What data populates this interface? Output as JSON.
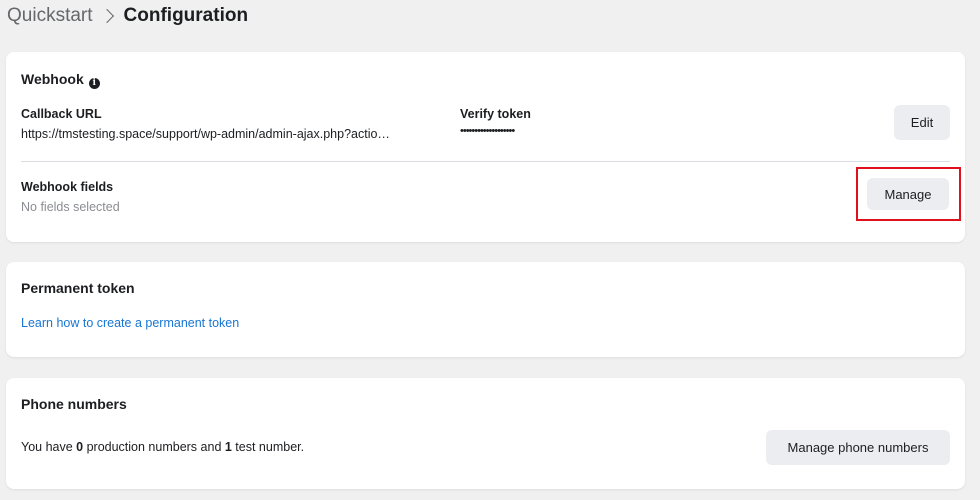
{
  "breadcrumb": {
    "parent": "Quickstart",
    "current": "Configuration"
  },
  "webhook": {
    "title": "Webhook",
    "info_icon": "info-icon",
    "callback_url_label": "Callback URL",
    "callback_url_value": "https://tmstesting.space/support/wp-admin/admin-ajax.php?actio…",
    "verify_token_label": "Verify token",
    "verify_token_value": "•••••••••••••••••••",
    "edit_button": "Edit",
    "fields_label": "Webhook fields",
    "fields_value": "No fields selected",
    "manage_button": "Manage",
    "highlight_color": "#e0101d"
  },
  "permanent_token": {
    "title": "Permanent token",
    "link": "Learn how to create a permanent token"
  },
  "phone_numbers": {
    "title": "Phone numbers",
    "text_prefix": "You have ",
    "production_count": "0",
    "text_middle": " production numbers and ",
    "test_count": "1",
    "text_suffix": " test number.",
    "manage_button": "Manage phone numbers"
  },
  "colors": {
    "background": "#f0f0f0",
    "card": "#ffffff",
    "link": "#1876d2",
    "button": "#ebedf0"
  }
}
